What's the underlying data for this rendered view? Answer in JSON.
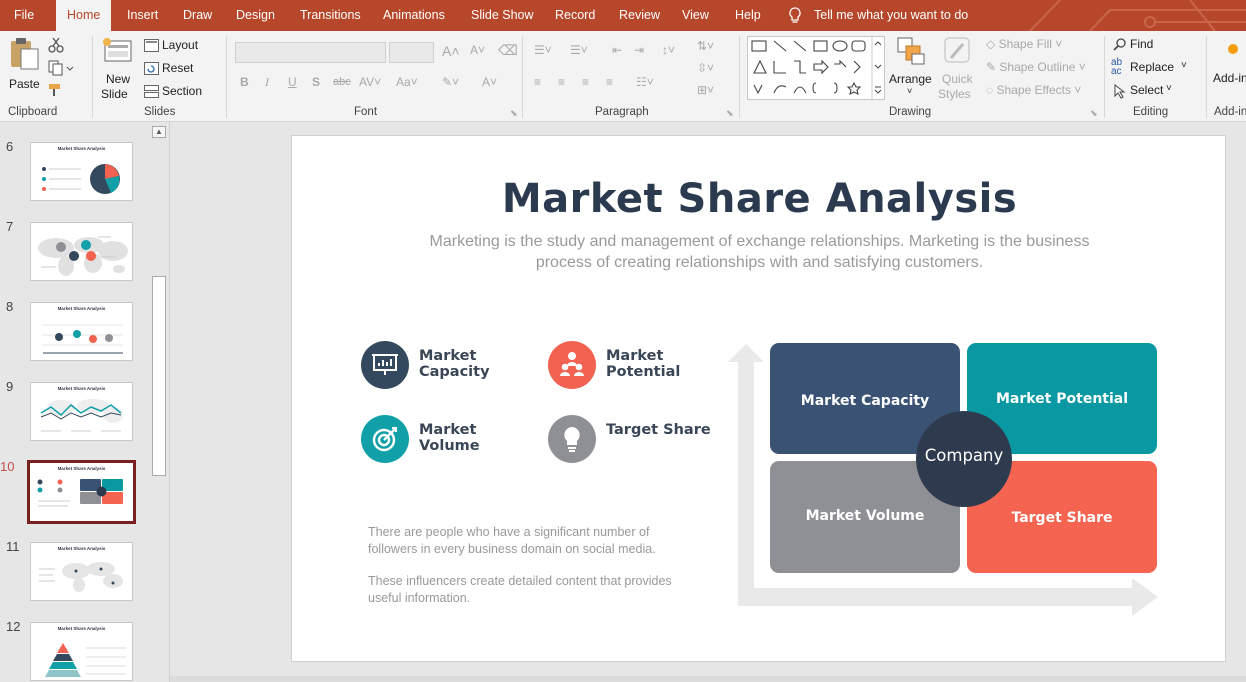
{
  "ribbon_tabs": [
    "File",
    "Home",
    "Insert",
    "Draw",
    "Design",
    "Transitions",
    "Animations",
    "Slide Show",
    "Record",
    "Review",
    "View",
    "Help"
  ],
  "active_tab": "Home",
  "tell_me": "Tell me what you want to do",
  "clipboard": {
    "paste": "Paste",
    "label": "Clipboard"
  },
  "slides_group": {
    "new_slide_1": "New",
    "new_slide_2": "Slide",
    "layout": "Layout",
    "reset": "Reset",
    "section": "Section",
    "label": "Slides"
  },
  "font_group": {
    "label": "Font"
  },
  "paragraph_group": {
    "label": "Paragraph"
  },
  "drawing_group": {
    "arrange": "Arrange",
    "quick_styles_1": "Quick",
    "quick_styles_2": "Styles",
    "shape_fill": "Shape Fill",
    "shape_outline": "Shape Outline",
    "shape_effects": "Shape Effects",
    "label": "Drawing"
  },
  "editing_group": {
    "find": "Find",
    "replace": "Replace",
    "select": "Select",
    "label": "Editing"
  },
  "addins_group": {
    "addins": "Add-ins",
    "label": "Add-ins"
  },
  "thumbnails": [
    {
      "number": "6",
      "title": "Market Share Analysis"
    },
    {
      "number": "7",
      "title": ""
    },
    {
      "number": "8",
      "title": "Market Share Analysis"
    },
    {
      "number": "9",
      "title": "Market Share Analysis"
    },
    {
      "number": "10",
      "title": "Market Share Analysis"
    },
    {
      "number": "11",
      "title": "Market Share Analysis"
    },
    {
      "number": "12",
      "title": "Market Share Analysis"
    }
  ],
  "selected_thumbnail": "10",
  "slide": {
    "title": "Market Share Analysis",
    "subtitle": "Marketing is the study and management of exchange relationships. Marketing is the business process of creating relationships with and satisfying customers.",
    "features": [
      {
        "label": "Market Capacity",
        "icon": "chart-board-icon",
        "color": "#34495e"
      },
      {
        "label": "Market Potential",
        "icon": "people-icon",
        "color": "#f26250"
      },
      {
        "label": "Market Volume",
        "icon": "target-icon",
        "color": "#12a0a8"
      },
      {
        "label": "Target Share",
        "icon": "lightbulb-icon",
        "color": "#8f8f96"
      }
    ],
    "paragraph1": "There are people who have a significant number of followers in every business domain on social media.",
    "paragraph2": "These influencers create detailed content that provides useful information.",
    "quadrants": {
      "top_left": "Market Capacity",
      "top_right": "Market Potential",
      "bottom_left": "Market Volume",
      "bottom_right": "Target Share",
      "center": "Company"
    },
    "colors": {
      "navy": "#3a5374",
      "teal": "#0a98a3",
      "gray": "#8f8f96",
      "coral": "#f46451",
      "center": "#2e3b4e"
    }
  }
}
